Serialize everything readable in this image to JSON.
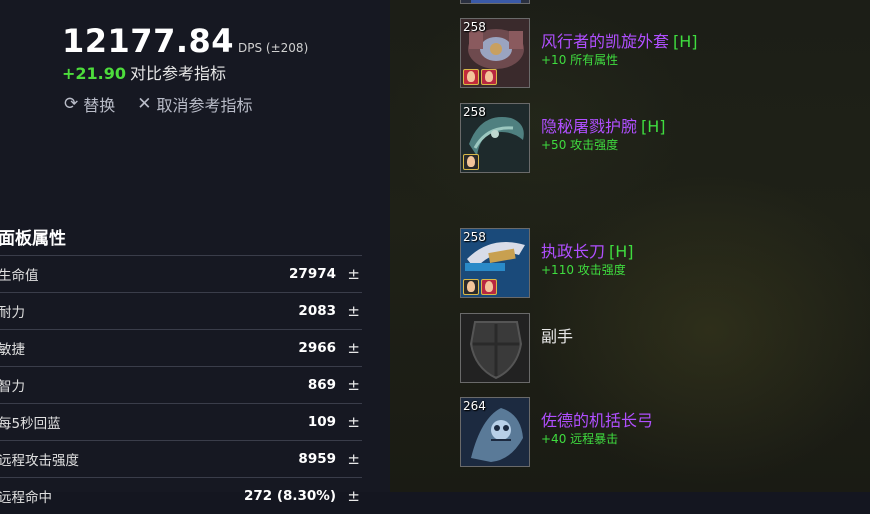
{
  "summary": {
    "dps_value": "12177.84",
    "dps_unit": "DPS (±208)",
    "diff_value": "+21.90",
    "diff_label": "对比参考指标",
    "replace_label": "替换",
    "cancel_label": "取消参考指标"
  },
  "stats": {
    "title": "面板属性",
    "rows": [
      {
        "name": "生命值",
        "value": "27974"
      },
      {
        "name": "耐力",
        "value": "2083"
      },
      {
        "name": "敏捷",
        "value": "2966"
      },
      {
        "name": "智力",
        "value": "869"
      },
      {
        "name": "每5秒回蓝",
        "value": "109"
      },
      {
        "name": "远程攻击强度",
        "value": "8959"
      },
      {
        "name": "远程命中",
        "value": "272 (8.30%)"
      }
    ],
    "adjust_symbol": "±"
  },
  "items": [
    {
      "ilvl": "258",
      "name": "风行者的凯旋外套",
      "tag": "[H]",
      "stat": "+10 所有属性"
    },
    {
      "ilvl": "258",
      "name": "隐秘屠戮护腕",
      "tag": "[H]",
      "stat": "+50 攻击强度"
    },
    {
      "ilvl": "258",
      "name": "执政长刀",
      "tag": "[H]",
      "stat": "+110 攻击强度"
    },
    {
      "ilvl": "",
      "name": "副手",
      "tag": "",
      "stat": ""
    },
    {
      "ilvl": "264",
      "name": "佐德的机括长弓",
      "tag": "",
      "stat": "+40 远程暴击"
    }
  ],
  "colors": {
    "epic": "#b04fff",
    "green": "#3fdc3f",
    "diff_green": "#4ddc3c"
  },
  "icons": [
    "refresh-icon",
    "close-icon",
    "gem-icon"
  ]
}
